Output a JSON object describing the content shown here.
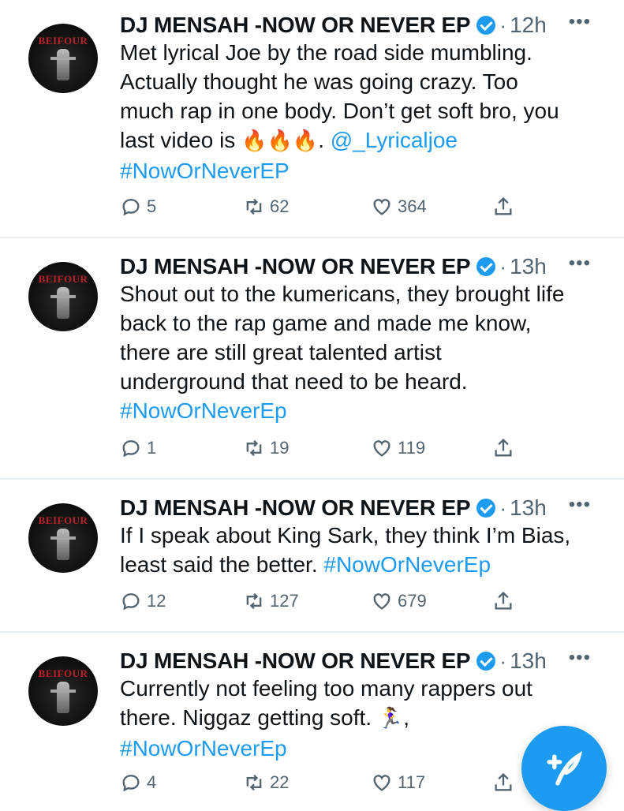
{
  "tweets": [
    {
      "name": "DJ MENSAH -NOW OR NEVER EP",
      "time": "12h",
      "avatar_text": "BEIFOUR",
      "lines": [
        [
          "Met lyrical Joe by the road side mumbling."
        ],
        [
          "Actually thought he was going crazy. Too"
        ],
        [
          "much rap in one body. Don’t get soft bro, you"
        ],
        [
          "last video is ",
          "🔥🔥🔥",
          ". ",
          "@_Lyricaljoe"
        ],
        [
          "#NowOrNeverEP"
        ]
      ],
      "replies": "5",
      "retweets": "62",
      "likes": "364"
    },
    {
      "name": "DJ MENSAH -NOW OR NEVER EP",
      "time": "13h",
      "avatar_text": "BEIFOUR",
      "lines": [
        [
          "Shout out to the kumericans, they brought life"
        ],
        [
          "back to the rap game and made me know,"
        ],
        [
          "there are still great talented artist"
        ],
        [
          "underground that need to be heard."
        ],
        [
          "#NowOrNeverEp"
        ]
      ],
      "replies": "1",
      "retweets": "19",
      "likes": "119"
    },
    {
      "name": "DJ MENSAH -NOW OR NEVER EP",
      "time": "13h",
      "avatar_text": "BEIFOUR",
      "lines": [
        [
          "If I speak about King Sark, they think I’m Bias,"
        ],
        [
          "least said the better. ",
          "#NowOrNeverEp"
        ]
      ],
      "replies": "12",
      "retweets": "127",
      "likes": "679"
    },
    {
      "name": "DJ MENSAH -NOW OR NEVER EP",
      "time": "13h",
      "avatar_text": "BEIFOUR",
      "lines": [
        [
          "Currently not feeling too many rappers out"
        ],
        [
          "there. Niggaz getting soft. ",
          "🏃‍♀️",
          ","
        ],
        [
          "#NowOrNeverEp"
        ]
      ],
      "replies": "4",
      "retweets": "22",
      "likes": "117"
    }
  ],
  "separator": "·",
  "more_glyph": "•••",
  "compose_icon": "feather-plus-icon",
  "colors": {
    "accent": "#1d9bf0",
    "text": "#0f1419",
    "muted": "#536471",
    "divider": "#e6ecf0"
  }
}
